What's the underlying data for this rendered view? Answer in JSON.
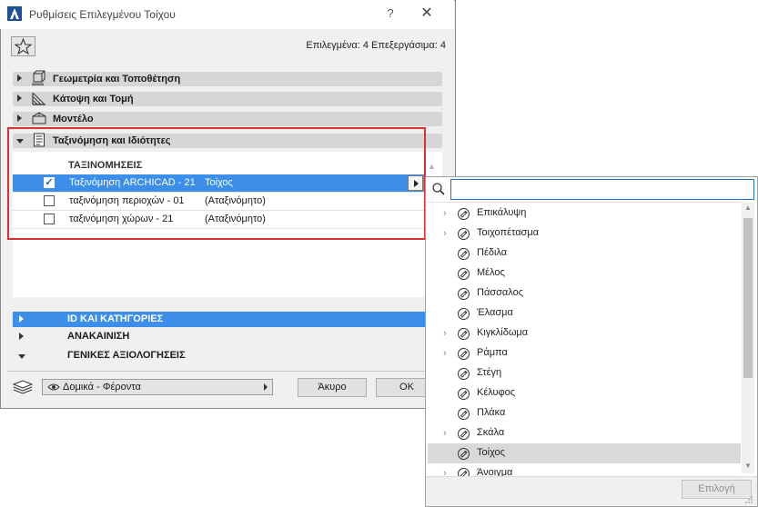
{
  "window": {
    "title": "Ρυθμίσεις Επιλεγμένου Τοίχου",
    "help_label": "?",
    "close_label": "✕"
  },
  "header": {
    "selection_info": "Επιλεγμένα: 4 Επεξεργάσιμα: 4"
  },
  "panels": [
    {
      "label": "Γεωμετρία και Τοποθέτηση",
      "expanded": false,
      "icon": "geometry-icon"
    },
    {
      "label": "Κάτοψη και Τομή",
      "expanded": false,
      "icon": "floorplan-icon"
    },
    {
      "label": "Μοντέλο",
      "expanded": false,
      "icon": "model-icon"
    },
    {
      "label": "Ταξινόμηση και Ιδιότητες",
      "expanded": true,
      "icon": "classification-icon"
    }
  ],
  "classifications": {
    "heading": "ΤΑΞΙΝΟΜΗΣΕΙΣ",
    "rows": [
      {
        "checked": true,
        "name": "Ταξινόμηση ARCHICAD - 21",
        "value": "Τοίχος",
        "selected": true
      },
      {
        "checked": false,
        "name": "ταξινόμηση περιοχών - 01",
        "value": "(Αταξινόμητο)",
        "selected": false
      },
      {
        "checked": false,
        "name": "ταξινόμηση χώρων - 21",
        "value": "(Αταξινόμητο)",
        "selected": false
      }
    ]
  },
  "sections": [
    {
      "label": "ID ΚΑΙ ΚΑΤΗΓΟΡΙΕΣ",
      "expanded": false,
      "highlighted": true
    },
    {
      "label": "ΑΝΑΚΑΙΝΙΣΗ",
      "expanded": false,
      "highlighted": false
    },
    {
      "label": "ΓΕΝΙΚΕΣ ΑΞΙΟΛΟΓΗΣΕΙΣ",
      "expanded": true,
      "highlighted": false
    }
  ],
  "footer": {
    "view_dropdown": "Δομικά - Φέροντα",
    "cancel_label": "Άκυρο",
    "ok_label": "OK"
  },
  "popup": {
    "search_value": "",
    "items": [
      {
        "label": "Επικάλυψη",
        "expandable": true,
        "selected": false
      },
      {
        "label": "Τοιχοπέτασμα",
        "expandable": true,
        "selected": false
      },
      {
        "label": "Πέδιλα",
        "expandable": false,
        "selected": false
      },
      {
        "label": "Μέλος",
        "expandable": false,
        "selected": false
      },
      {
        "label": "Πάσσαλος",
        "expandable": false,
        "selected": false
      },
      {
        "label": "Έλασμα",
        "expandable": false,
        "selected": false
      },
      {
        "label": "Κιγκλίδωμα",
        "expandable": true,
        "selected": false
      },
      {
        "label": "Ράμπα",
        "expandable": true,
        "selected": false
      },
      {
        "label": "Στέγη",
        "expandable": false,
        "selected": false
      },
      {
        "label": "Κέλυφος",
        "expandable": false,
        "selected": false
      },
      {
        "label": "Πλάκα",
        "expandable": false,
        "selected": false
      },
      {
        "label": "Σκάλα",
        "expandable": true,
        "selected": false
      },
      {
        "label": "Τοίχος",
        "expandable": false,
        "selected": true
      },
      {
        "label": "Άνοιγμα",
        "expandable": true,
        "selected": false
      }
    ],
    "choose_label": "Επιλογή"
  },
  "colors": {
    "selection_blue": "#3d8ee8",
    "highlight_red": "#d93030",
    "search_border": "#1f74c9"
  }
}
